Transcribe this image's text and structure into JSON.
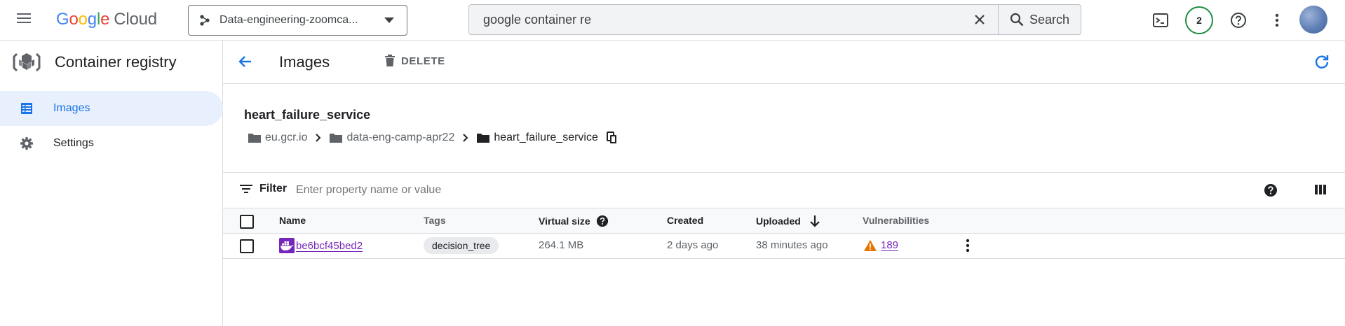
{
  "colors": {
    "accent": "#1a73e8",
    "link": "#7627bb",
    "warning": "#e37400",
    "badge_border": "#1e8e3e",
    "selected_bg": "#e8f0fe"
  },
  "topbar": {
    "logo_brand": "Google",
    "logo_product": "Cloud",
    "project_name": "Data-engineering-zoomca...",
    "search_value": "google container re",
    "search_button": "Search",
    "notification_count": "2"
  },
  "sidebar": {
    "title": "Container registry",
    "items": [
      {
        "label": "Images",
        "icon": "list-icon",
        "selected": true
      },
      {
        "label": "Settings",
        "icon": "gear-icon",
        "selected": false
      }
    ]
  },
  "main": {
    "title": "Images",
    "delete_label": "DELETE",
    "repository": "heart_failure_service",
    "breadcrumb": [
      "eu.gcr.io",
      "data-eng-camp-apr22",
      "heart_failure_service"
    ],
    "filter_label": "Filter",
    "filter_placeholder": "Enter property name or value"
  },
  "table": {
    "columns": [
      "Name",
      "Tags",
      "Virtual size",
      "Created",
      "Uploaded",
      "Vulnerabilities"
    ],
    "rows": [
      {
        "name": "be6bcf45bed2",
        "tag": "decision_tree",
        "virtual_size": "264.1 MB",
        "created": "2 days ago",
        "uploaded": "38 minutes ago",
        "vulnerabilities": "189"
      }
    ]
  }
}
